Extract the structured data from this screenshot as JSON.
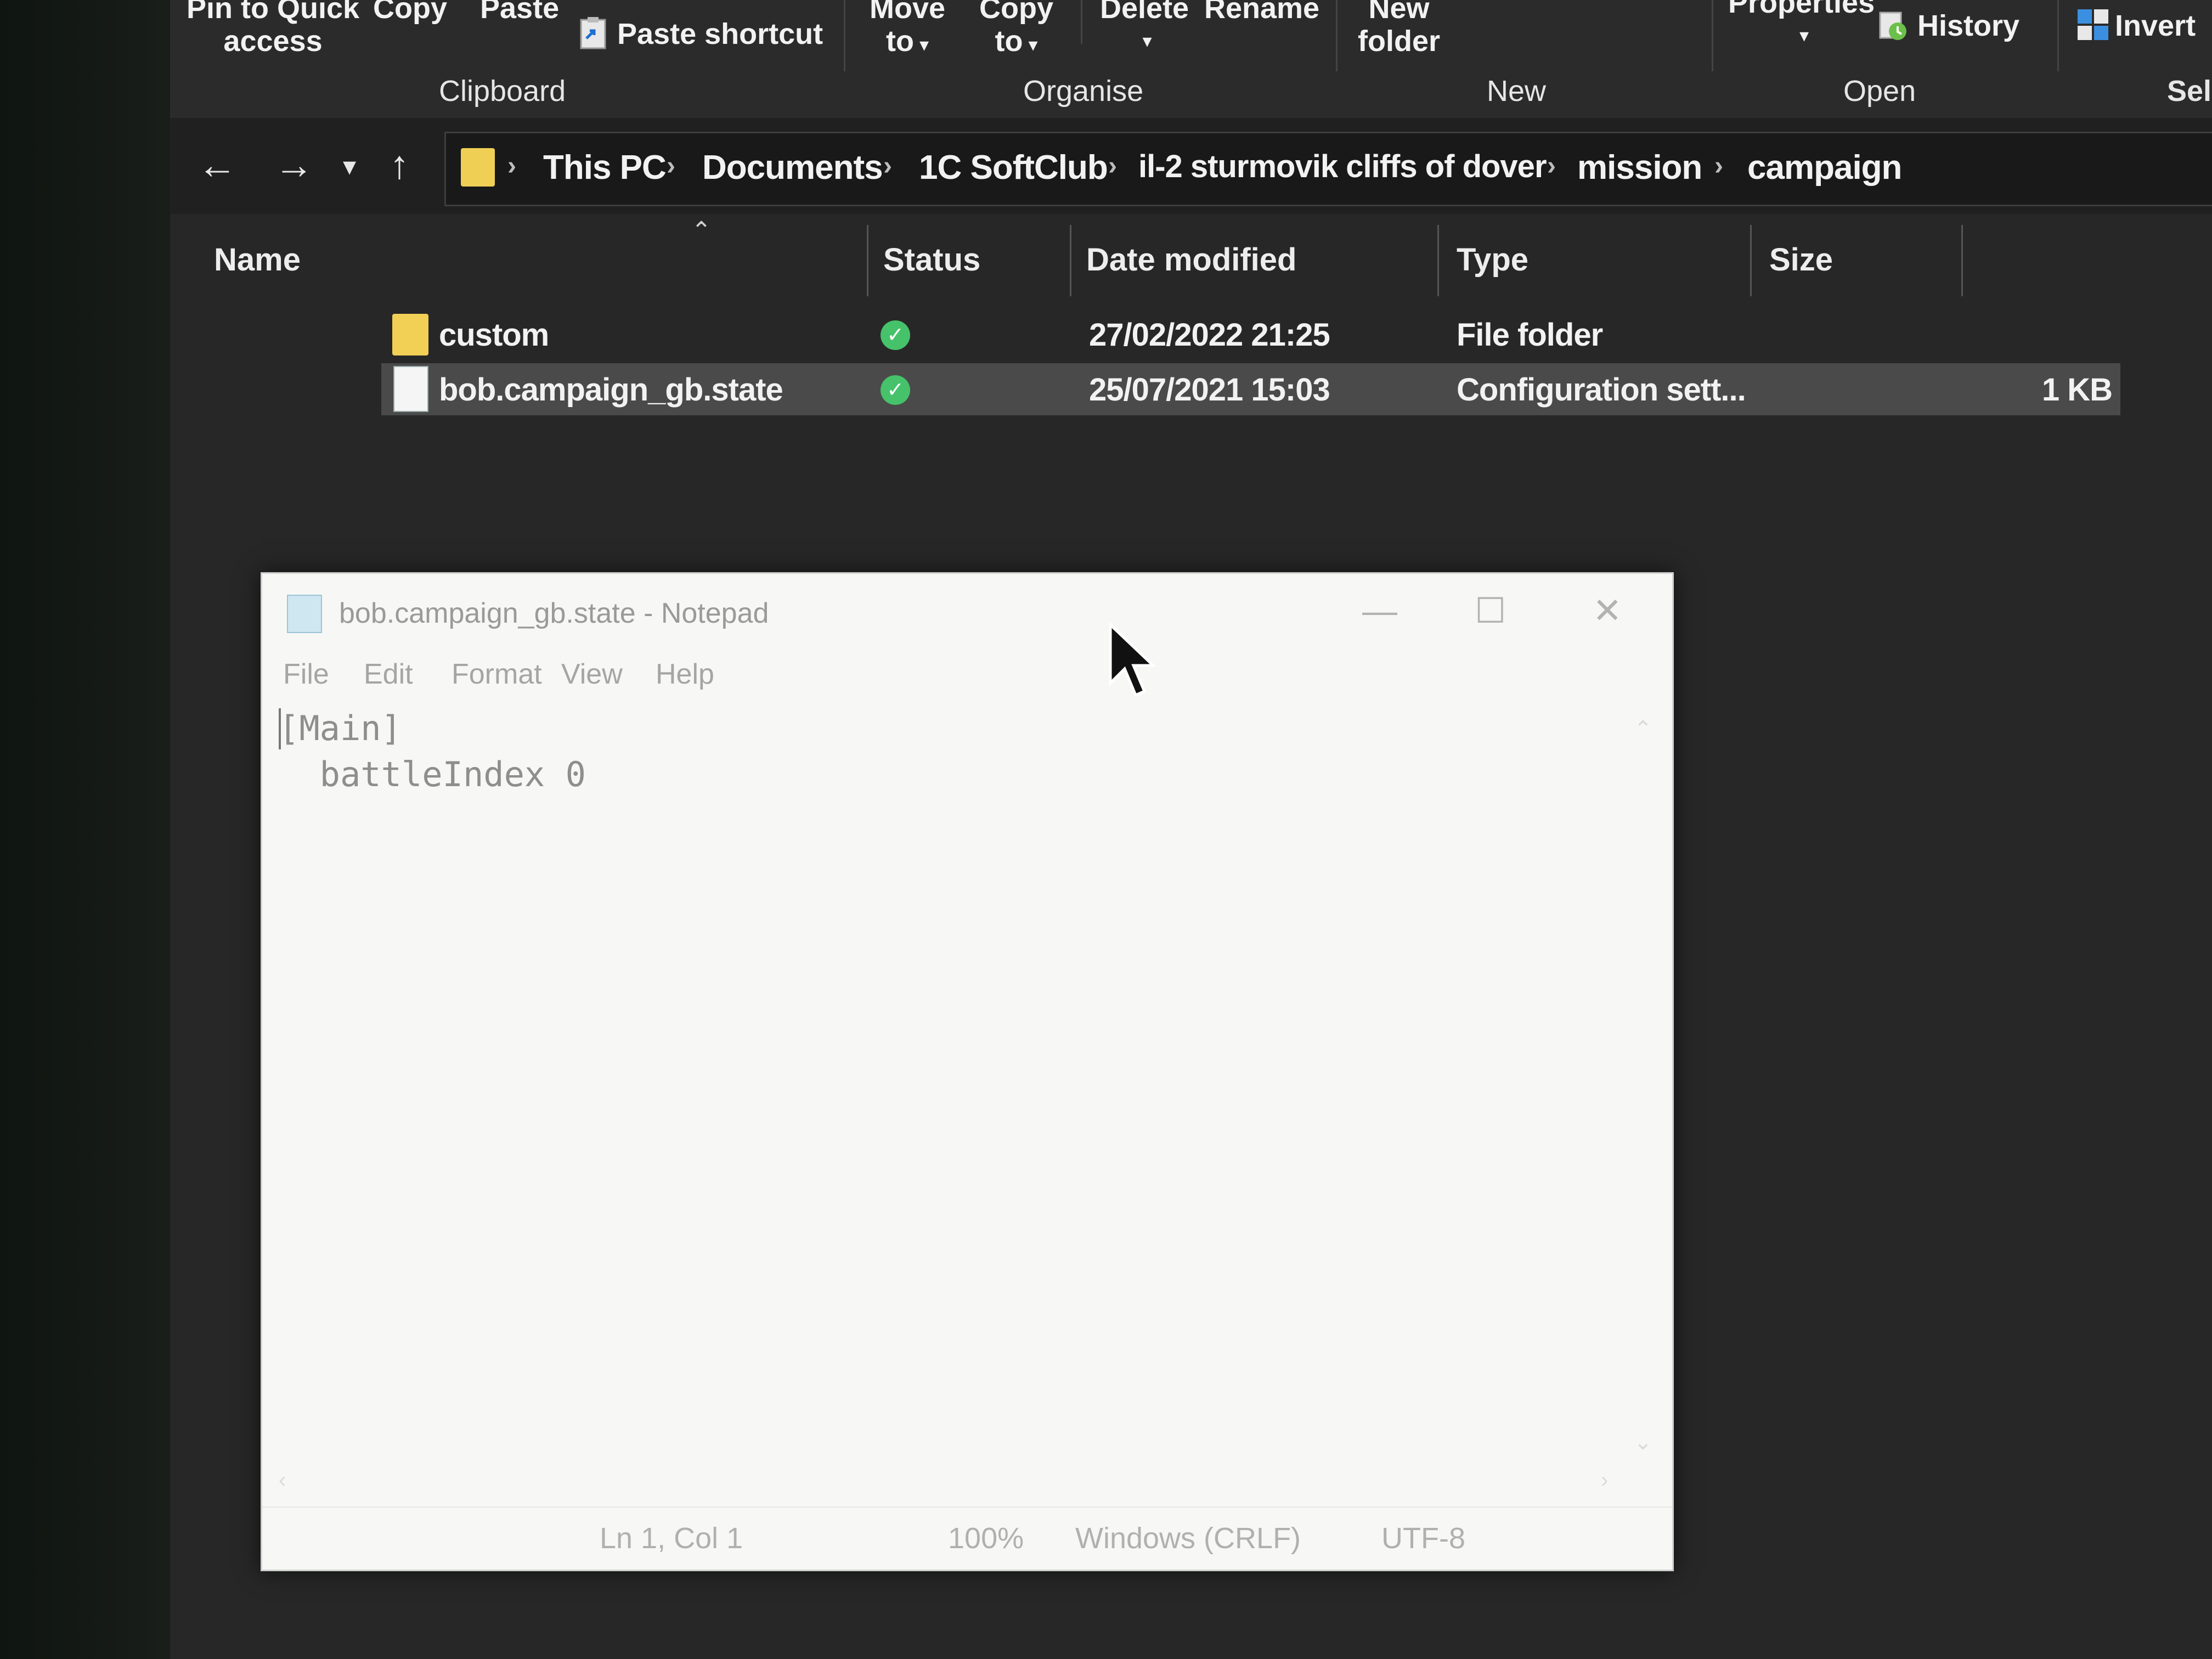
{
  "ribbon": {
    "clipboard": {
      "pin_line1": "Pin to Quick",
      "pin_line2": "access",
      "copy": "Copy",
      "paste": "Paste",
      "paste_shortcut": "Paste shortcut",
      "group": "Clipboard"
    },
    "organise": {
      "move_line1": "Move",
      "move_line2": "to",
      "copy_line1": "Copy",
      "copy_line2": "to",
      "delete": "Delete",
      "rename": "Rename",
      "group": "Organise"
    },
    "new": {
      "new_folder_line1": "New",
      "new_folder_line2": "folder",
      "group": "New"
    },
    "open": {
      "properties": "Properties",
      "history": "History",
      "group": "Open"
    },
    "select": {
      "invert": "Invert",
      "group": "Sel"
    }
  },
  "address": {
    "crumbs": [
      "This PC",
      "Documents",
      "1C SoftClub",
      "il-2 sturmovik cliffs of dover",
      "mission",
      "campaign"
    ],
    "separator": "›"
  },
  "columns": {
    "name": "Name",
    "status": "Status",
    "date_modified": "Date modified",
    "type": "Type",
    "size": "Size"
  },
  "files": [
    {
      "name": "custom",
      "date": "27/02/2022 21:25",
      "type": "File folder",
      "size": "",
      "icon": "folder-icon"
    },
    {
      "name": "bob.campaign_gb.state",
      "date": "25/07/2021 15:03",
      "type": "Configuration sett...",
      "size": "1 KB",
      "icon": "document-icon"
    }
  ],
  "notepad": {
    "title": "bob.campaign_gb.state - Notepad",
    "menu": [
      "File",
      "Edit",
      "Format",
      "View",
      "Help"
    ],
    "content": "[Main]\n  battleIndex 0",
    "status": {
      "position": "Ln 1, Col 1",
      "zoom": "100%",
      "line_ending": "Windows (CRLF)",
      "encoding": "UTF-8"
    }
  },
  "colors": {
    "explorer_bg": "#272727",
    "folder": "#f2cf55",
    "status_ok": "#45c26a",
    "selected_row": "#4a4a4a",
    "notepad_bg": "#f7f8f5"
  }
}
